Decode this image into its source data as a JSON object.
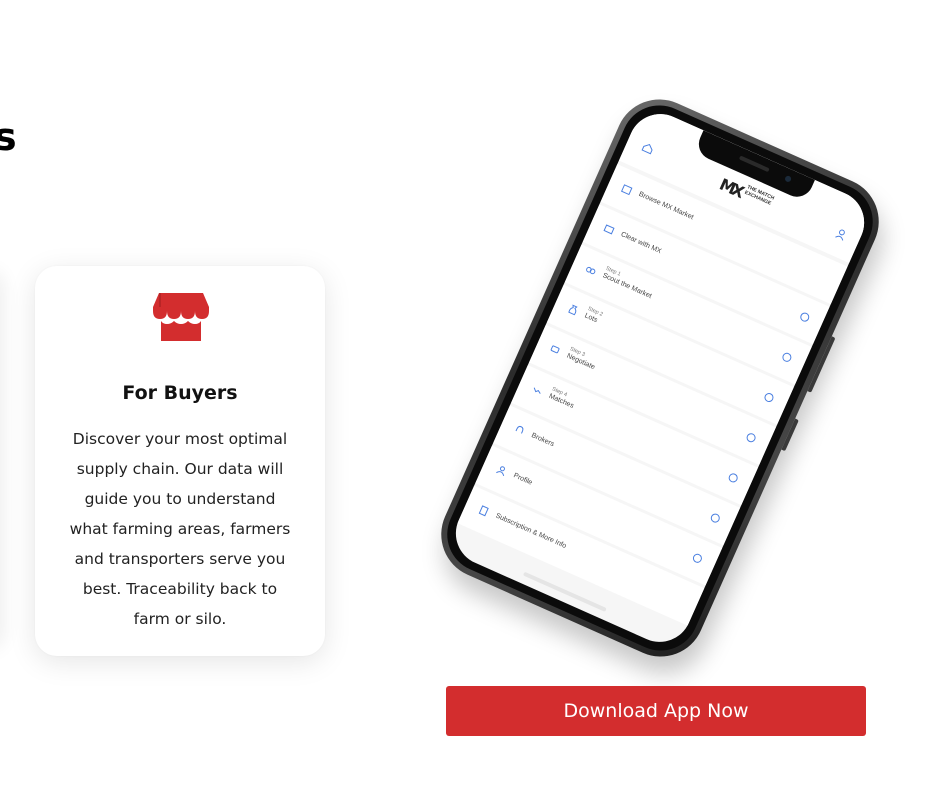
{
  "section": {
    "heading_partial": "s"
  },
  "buyers_card": {
    "icon": "storefront-icon",
    "title": "For Buyers",
    "description_lines": [
      "Discover your most optimal",
      "supply chain. Our data will",
      "guide you to understand",
      "what farming areas, farmers",
      "and transporters serve you",
      "best. Traceability back to",
      "farm or silo."
    ]
  },
  "phone_app": {
    "logo_mark": "MX",
    "logo_text": "THE MATCH EXCHANGE",
    "menu": [
      {
        "step": "",
        "label": "Browse MX Market"
      },
      {
        "step": "",
        "label": "Clear with MX"
      },
      {
        "step": "Step 1",
        "label": "Scout the Market"
      },
      {
        "step": "Step 2",
        "label": "Lots"
      },
      {
        "step": "Step 3",
        "label": "Negotiate"
      },
      {
        "step": "Step 4",
        "label": "Matches"
      },
      {
        "step": "",
        "label": "Brokers"
      },
      {
        "step": "",
        "label": "Profile"
      },
      {
        "step": "",
        "label": "Subscription & More Info"
      }
    ]
  },
  "cta": {
    "download_label": "Download App Now"
  },
  "colors": {
    "accent_red": "#d32d2e",
    "info_blue": "#4a7fe0"
  }
}
